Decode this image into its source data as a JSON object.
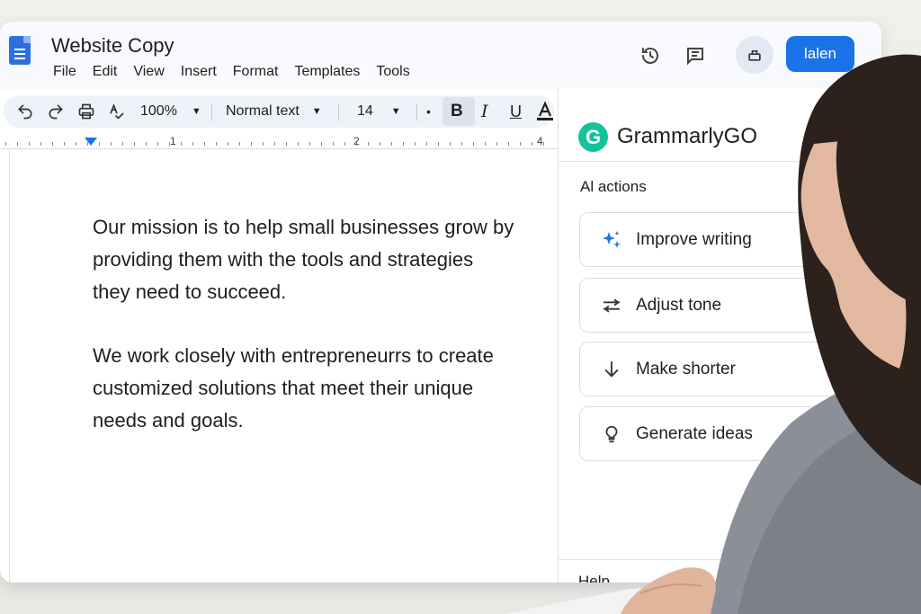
{
  "document": {
    "title": "Website Copy",
    "menu": [
      "File",
      "Edit",
      "View",
      "Insert",
      "Format",
      "Templates",
      "Tools"
    ],
    "share_label": "lalen"
  },
  "toolbar": {
    "zoom": "100%",
    "style": "Normal text",
    "font_size": "14",
    "bullet": "•"
  },
  "ruler": {
    "marks": [
      "1",
      "2",
      "4"
    ]
  },
  "body": {
    "paragraph_1_lines": [
      "Our mission is to help small businesses grow by",
      "providing them with the tools and strategies",
      "they need to succeed."
    ],
    "paragraph_2_lines": [
      "We work closely with entrepreneurrs to create",
      "customized solutions that meet their unique",
      "needs and goals."
    ]
  },
  "panel": {
    "logo_letter": "G",
    "title": "GrammarlyGO",
    "section_label": "Al actions",
    "actions": [
      {
        "label": "Improve writing",
        "icon": "sparkle-icon"
      },
      {
        "label": "Adjust tone",
        "icon": "sliders-icon"
      },
      {
        "label": "Make shorter",
        "icon": "arrow-down-icon"
      },
      {
        "label": "Generate ideas",
        "icon": "lightbulb-icon"
      }
    ],
    "help_label": "Help"
  },
  "colors": {
    "accent_blue": "#1a73e8",
    "grammarly_green": "#15c39a",
    "header_bg": "#f8fafd"
  }
}
